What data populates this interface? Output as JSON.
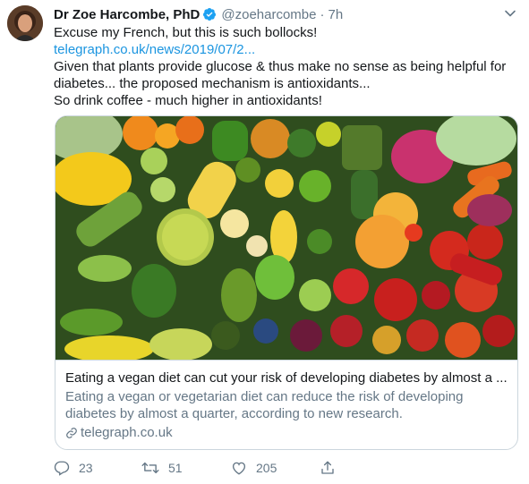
{
  "author": {
    "display_name": "Dr Zoe Harcombe, PhD",
    "handle": "@zoeharcombe",
    "separator": "·",
    "time": "7h"
  },
  "tweet": {
    "lines": [
      "Excuse my French, but this is such bollocks!",
      "telegraph.co.uk/news/2019/07/2...",
      "Given that plants provide glucose & thus make no sense as being helpful for",
      "diabetes... the proposed mechanism is antioxidants...",
      "So drink coffee - much higher in antioxidants!"
    ]
  },
  "card": {
    "title": "Eating a vegan diet can cut your risk of developing diabetes by almost a ...",
    "description": "Eating a vegan or vegetarian diet can reduce the risk of developing diabetes by almost a quarter, according to new research.",
    "domain": "telegraph.co.uk"
  },
  "actions": {
    "reply_count": "23",
    "retweet_count": "51",
    "like_count": "205"
  },
  "colors": {
    "link": "#1b95e0",
    "secondary_text": "#657786",
    "verified": "#1da1f2",
    "border": "#ccd6dd"
  },
  "icons": [
    "verified-icon",
    "chevron-down-icon",
    "link-icon",
    "reply-icon",
    "retweet-icon",
    "like-icon",
    "share-icon"
  ]
}
